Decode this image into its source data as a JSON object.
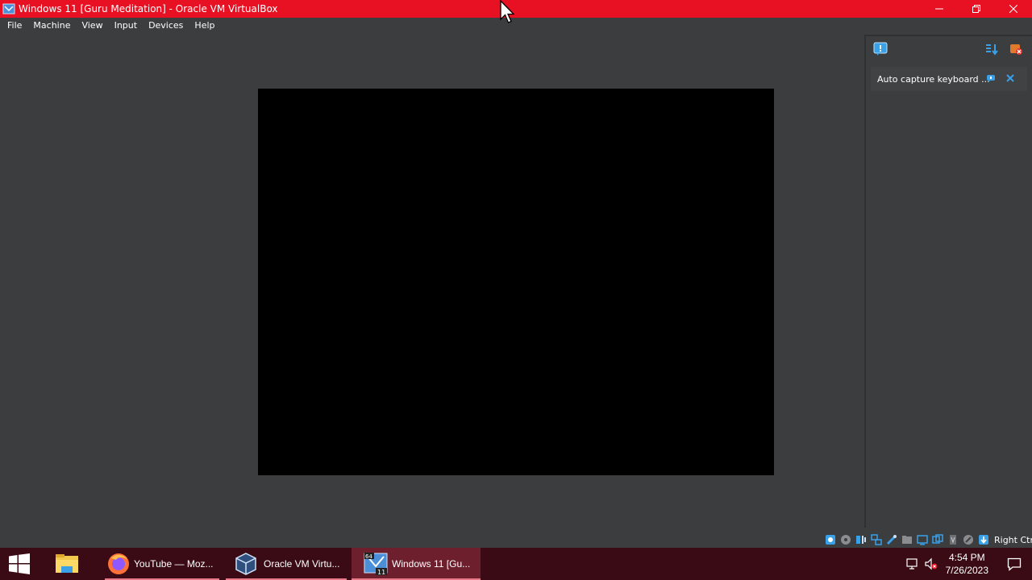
{
  "window": {
    "title": "Windows 11 [Guru Meditation] - Oracle VM VirtualBox",
    "controls": {
      "minimize": "—",
      "restore": "❐",
      "close": "✕"
    }
  },
  "menu": [
    "File",
    "Machine",
    "View",
    "Input",
    "Devices",
    "Help"
  ],
  "notification": {
    "text": "Auto capture keyboard ...",
    "icons": [
      "notification-center-icon",
      "sort-icon",
      "close-all-icon",
      "help-icon",
      "dismiss-icon"
    ]
  },
  "status_bar": {
    "host_key": "Right Ctrl"
  },
  "taskbar": {
    "apps": [
      {
        "label": "YouTube — Moz...",
        "icon": "firefox-icon"
      },
      {
        "label": "Oracle VM Virtu...",
        "icon": "virtualbox-icon"
      },
      {
        "label": "Windows 11 [Gu...",
        "icon": "vm-window-icon",
        "badge_top": "64",
        "badge_bottom": "11"
      }
    ],
    "time": "4:54 PM",
    "date": "7/26/2023"
  },
  "colors": {
    "titlebar": "#e81123",
    "taskbar": "#3a0b14",
    "background": "#3b3d3f",
    "vm_screen": "#000000"
  }
}
